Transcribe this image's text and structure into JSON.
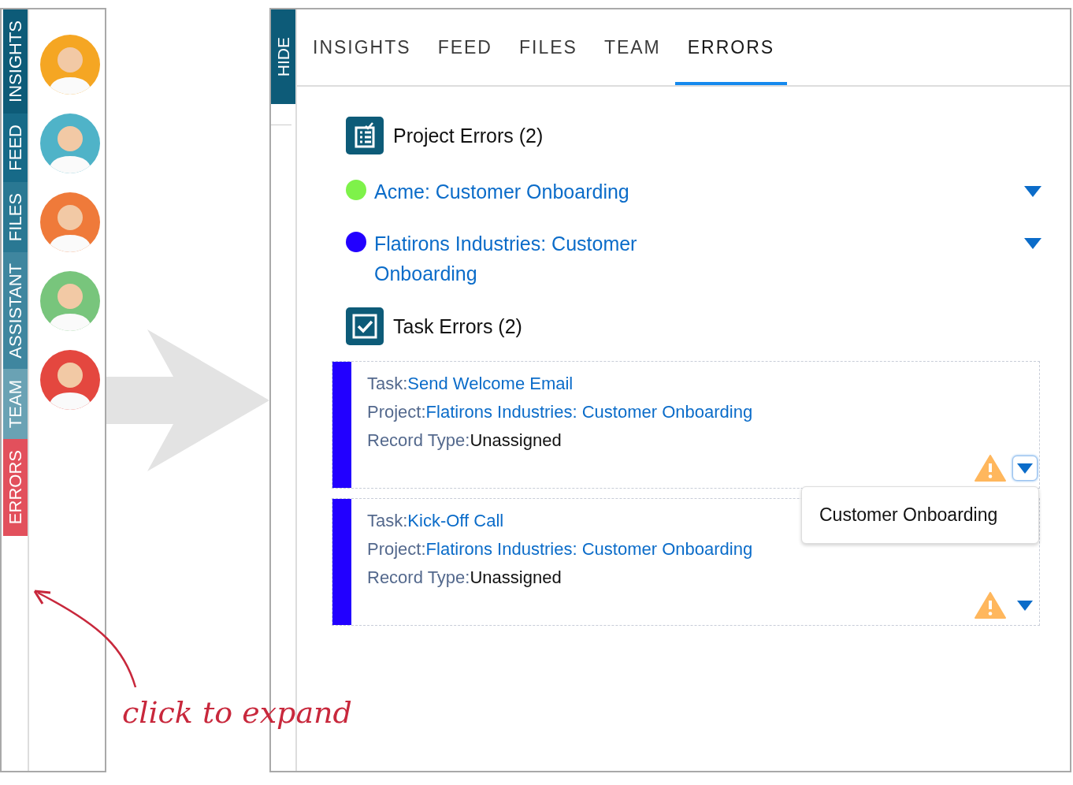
{
  "side_tabs": [
    {
      "label": "INSIGHTS",
      "color": "#0d5b78"
    },
    {
      "label": "FEED",
      "color": "#176a88"
    },
    {
      "label": "FILES",
      "color": "#2a7893"
    },
    {
      "label": "ASSISTANT",
      "color": "#3f869f"
    },
    {
      "label": "TEAM",
      "color": "#6aa2b4"
    },
    {
      "label": "ERRORS",
      "color": "#e2505c"
    }
  ],
  "avatars": [
    {
      "color": "#f5a623"
    },
    {
      "color": "#4fb3c8"
    },
    {
      "color": "#ef7a3a"
    },
    {
      "color": "#78c57c"
    },
    {
      "color": "#e4473f"
    }
  ],
  "annotation": "click to expand",
  "panel": {
    "hide_tab": "HIDE",
    "tabs": [
      {
        "label": "INSIGHTS",
        "selected": false
      },
      {
        "label": "FEED",
        "selected": false
      },
      {
        "label": "FILES",
        "selected": false
      },
      {
        "label": "TEAM",
        "selected": false
      },
      {
        "label": "ERRORS",
        "selected": true
      }
    ],
    "project_errors": {
      "title": "Project Errors (2)",
      "items": [
        {
          "name": "Acme: Customer Onboarding",
          "color": "#7ef24a"
        },
        {
          "name": "Flatirons Industries: Customer Onboarding",
          "color": "#2200ff"
        }
      ]
    },
    "task_errors": {
      "title": "Task Errors (2)",
      "items": [
        {
          "task_label": "Task:",
          "task": "Send Welcome Email",
          "project_label": "Project:",
          "project": "Flatirons Industries: Customer Onboarding",
          "type_label": "Record Type:",
          "type": "Unassigned",
          "color": "#2200ff",
          "menu_open": true
        },
        {
          "task_label": "Task:",
          "task": "Kick-Off Call",
          "project_label": "Project:",
          "project": "Flatirons Industries: Customer Onboarding",
          "type_label": "Record Type:",
          "type": "Unassigned",
          "color": "#2200ff",
          "menu_open": false
        }
      ]
    },
    "menu": {
      "items": [
        "Customer Onboarding"
      ]
    }
  }
}
